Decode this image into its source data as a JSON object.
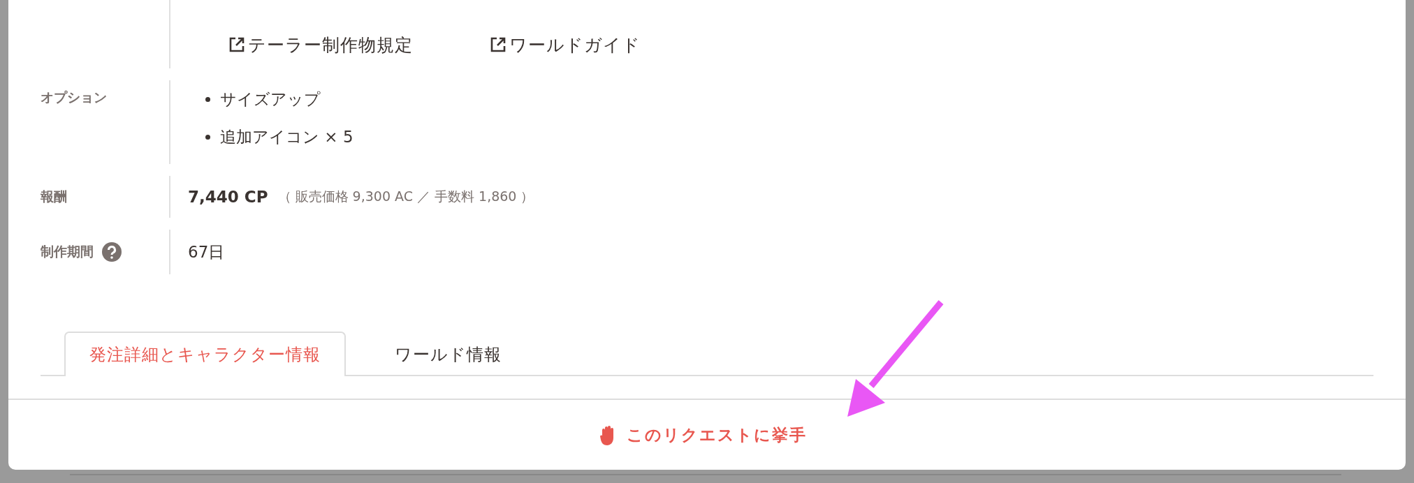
{
  "links": [
    {
      "label": "テーラー制作物規定"
    },
    {
      "label": "ワールドガイド"
    }
  ],
  "fields": [
    {
      "kind": "list",
      "label": "オプション",
      "items": [
        "サイズアップ",
        "追加アイコン × 5"
      ]
    },
    {
      "kind": "price",
      "label": "報酬",
      "amount": "7,440 CP",
      "detail": "（ 販売価格 9,300 AC ／ 手数料 1,860 ）"
    },
    {
      "kind": "text",
      "label": "制作期間",
      "help": true,
      "value": "67日"
    }
  ],
  "tabs": [
    {
      "label": "発注詳細とキャラクター情報",
      "selected": true
    },
    {
      "label": "ワールド情報",
      "selected": false
    }
  ],
  "action": {
    "label": "このリクエストに挙手"
  }
}
